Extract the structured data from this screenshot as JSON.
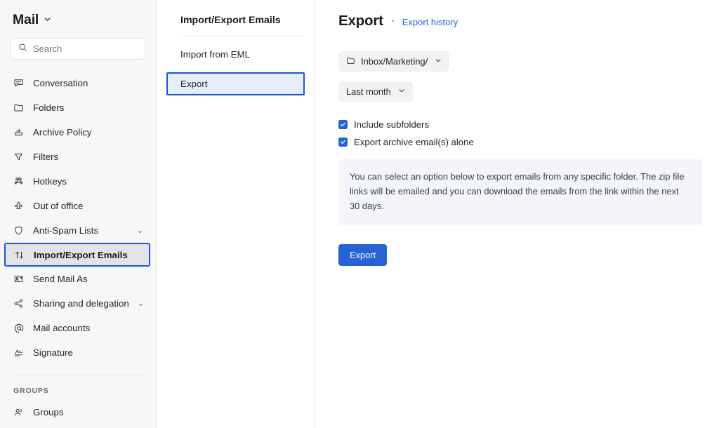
{
  "sidebar": {
    "brand": {
      "title": "Mail",
      "caret": "⌄"
    },
    "search": {
      "placeholder": "Search",
      "value": "",
      "icon": "search-icon"
    },
    "items": [
      {
        "label": "Conversation",
        "icon": "conversation-icon",
        "caret": "",
        "selected": false
      },
      {
        "label": "Folders",
        "icon": "folder-icon",
        "caret": "",
        "selected": false
      },
      {
        "label": "Archive Policy",
        "icon": "archive-icon",
        "caret": "",
        "selected": false
      },
      {
        "label": "Filters",
        "icon": "filter-icon",
        "caret": "",
        "selected": false
      },
      {
        "label": "Hotkeys",
        "icon": "command-icon",
        "caret": "",
        "selected": false
      },
      {
        "label": "Out of office",
        "icon": "out-of-office-icon",
        "caret": "",
        "selected": false
      },
      {
        "label": "Anti-Spam Lists",
        "icon": "shield-icon",
        "caret": "⌄",
        "selected": false
      },
      {
        "label": "Import/Export Emails",
        "icon": "import-export-icon",
        "caret": "",
        "selected": true
      },
      {
        "label": "Send Mail As",
        "icon": "send-mail-as-icon",
        "caret": "",
        "selected": false
      },
      {
        "label": "Sharing and delegation",
        "icon": "share-icon",
        "caret": "⌄",
        "selected": false
      },
      {
        "label": "Mail accounts",
        "icon": "at-sign-icon",
        "caret": "",
        "selected": false
      },
      {
        "label": "Signature",
        "icon": "signature-icon",
        "caret": "",
        "selected": false
      }
    ],
    "groups_section": {
      "header": "GROUPS",
      "items": [
        {
          "label": "Groups",
          "icon": "users-icon"
        }
      ]
    }
  },
  "midcol": {
    "title": "Import/Export Emails",
    "items": [
      {
        "label": "Import from EML",
        "active": false
      },
      {
        "label": "Export",
        "active": true
      }
    ]
  },
  "main": {
    "title": "Export",
    "history_link": "Export history",
    "folder_select": {
      "value": "Inbox/Marketing/",
      "icon": "folder-icon",
      "caret": "⌄"
    },
    "period_select": {
      "value": "Last month",
      "caret": "⌄"
    },
    "checkboxes": [
      {
        "label": "Include subfolders",
        "checked": true
      },
      {
        "label": "Export archive email(s) alone",
        "checked": true
      }
    ],
    "info_text": "You can select an option below to export emails from any specific folder. The zip file links will be emailed and you can download the emails from the link within the next 30 days.",
    "export_button": "Export"
  },
  "colors": {
    "accent": "#2563d6",
    "focus_ring": "#1a56db",
    "sidebar_bg": "#f7f7f8",
    "pill_bg": "#f2f2f4",
    "info_bg": "#f3f5f9",
    "text": "#26262b"
  }
}
